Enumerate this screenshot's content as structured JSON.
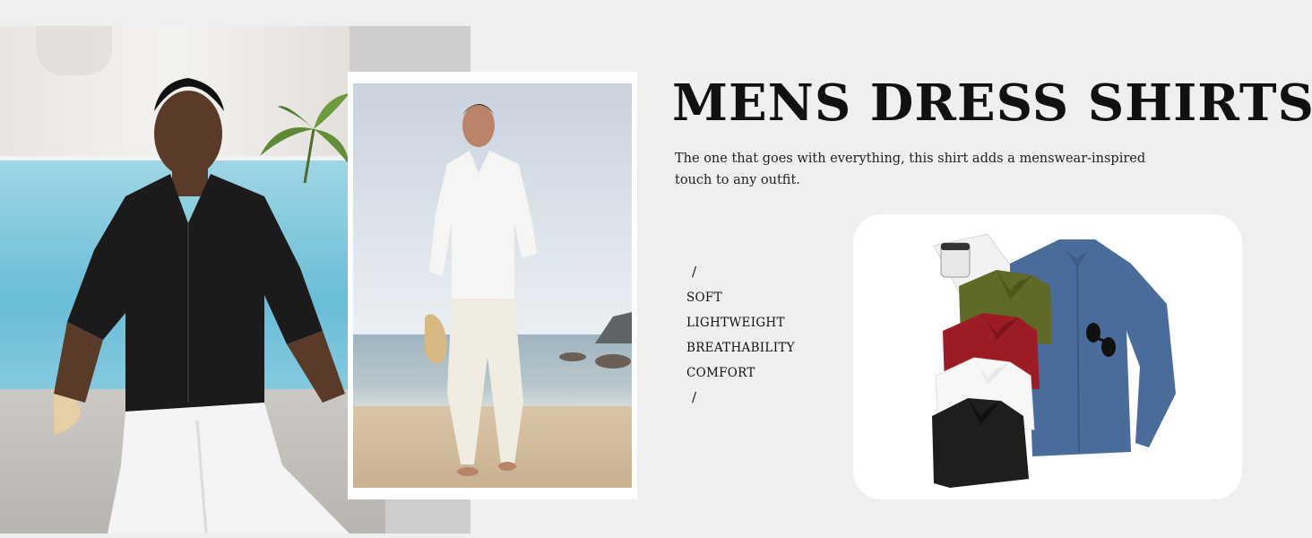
{
  "header": {
    "title": "MENS DRESS SHIRTS"
  },
  "description": "The one that goes with everything, this shirt adds a menswear-inspired touch to any outfit.",
  "features": {
    "divider_top": "/",
    "items": [
      "SOFT",
      "LIGHTWEIGHT",
      "BREATHABILITY",
      "COMFORT"
    ],
    "divider_bottom": "/"
  },
  "colors": {
    "background": "#efefef",
    "shirt_blue": "#4a6c9a",
    "shirt_olive": "#5e6a25",
    "shirt_red": "#9c1c25",
    "shirt_white": "#f7f7f7",
    "shirt_black": "#1e1e1e"
  }
}
